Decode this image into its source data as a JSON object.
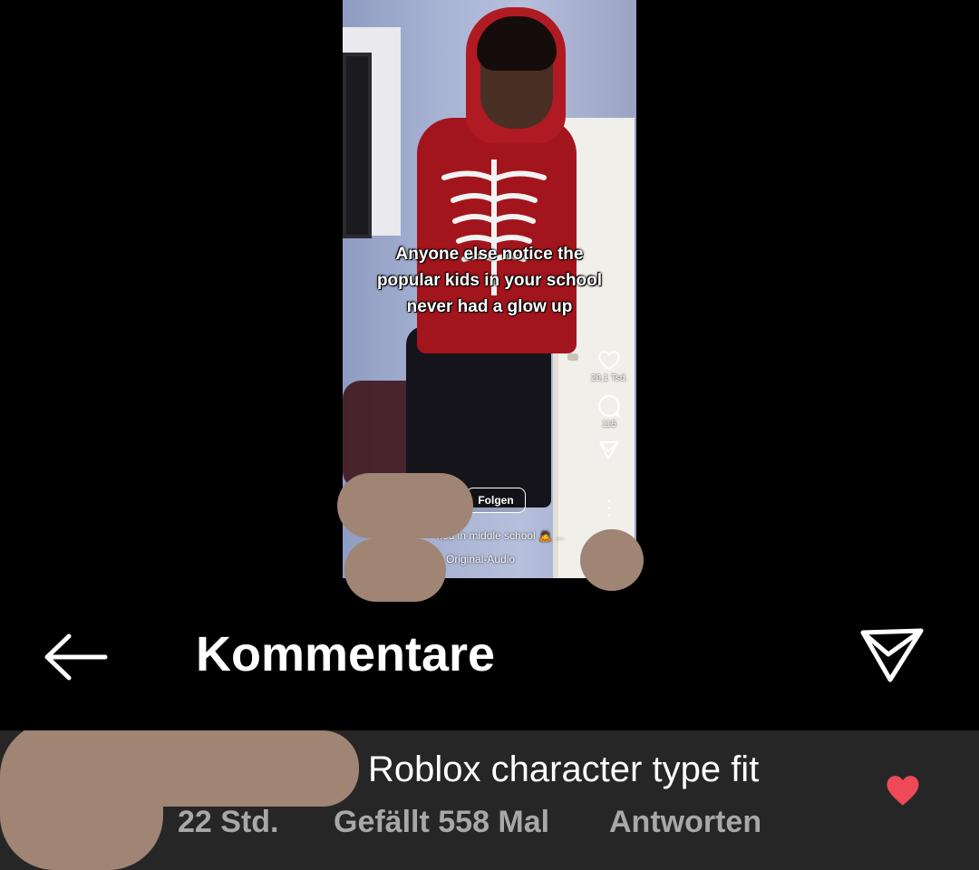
{
  "video": {
    "caption_lines": [
      "Anyone else notice the",
      "popular kids in your school",
      "never had a glow up"
    ],
    "likes_count": "20,1 Tsd.",
    "comments_count": "115",
    "follow_label": "Folgen",
    "description": "ked in middle school 🙇 ...",
    "audio_label": "Original-Audio"
  },
  "header": {
    "title": "Kommentare",
    "back_icon": "arrow-left-icon",
    "share_icon": "send-icon"
  },
  "comment": {
    "text": "Roblox character type fit",
    "time": "22 Std.",
    "likes": "Gefällt 558 Mal",
    "reply_label": "Antworten",
    "heart_color": "#ed4956",
    "liked": true
  },
  "colors": {
    "background": "#000000",
    "comment_bg": "#262626",
    "meta_text": "#a8a8a8",
    "redaction": "#a08474"
  }
}
